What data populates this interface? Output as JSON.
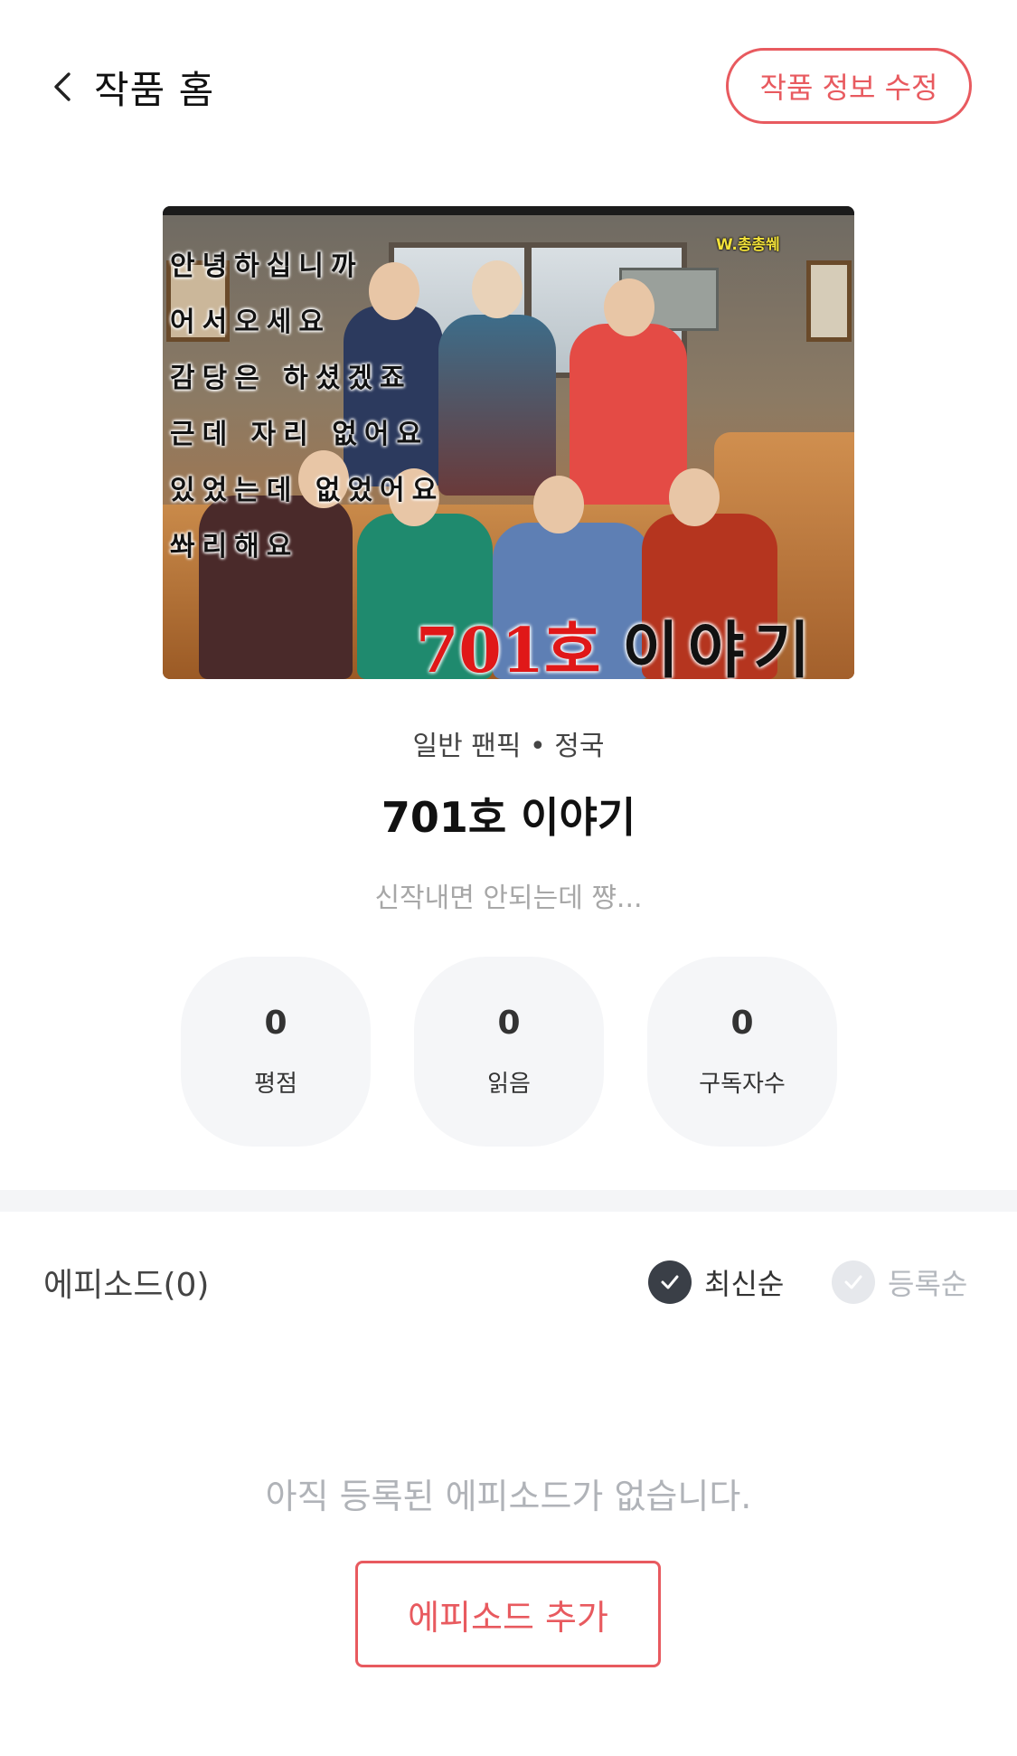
{
  "header": {
    "back_label": "작품 홈",
    "edit_label": "작품 정보 수정"
  },
  "cover": {
    "lines": [
      "안녕하십니까",
      "어서오세요",
      "감당은 하셨겠죠",
      "근데 자리 없어요",
      "있었는데 없었어요",
      "쏴리해요"
    ],
    "author": "W.총총쒜",
    "title_number": "701호",
    "title_rest": "이야기"
  },
  "work": {
    "meta": "일반 팬픽 • 정국",
    "title": "701호 이야기",
    "description": "신작내면 안되는데 쨩..."
  },
  "stats": [
    {
      "value": "0",
      "label": "평점"
    },
    {
      "value": "0",
      "label": "읽음"
    },
    {
      "value": "0",
      "label": "구독자수"
    }
  ],
  "episodes": {
    "title": "에피소드(0)",
    "sort_latest": "최신순",
    "sort_registered": "등록순",
    "empty_message": "아직 등록된 에피소드가 없습니다.",
    "add_label": "에피소드 추가"
  },
  "colors": {
    "accent": "#e85a5f",
    "selected_check": "#3a3f47",
    "unselected_check": "#e6e8ec"
  },
  "icons": {
    "back": "chevron-left-icon",
    "check": "check-icon"
  }
}
